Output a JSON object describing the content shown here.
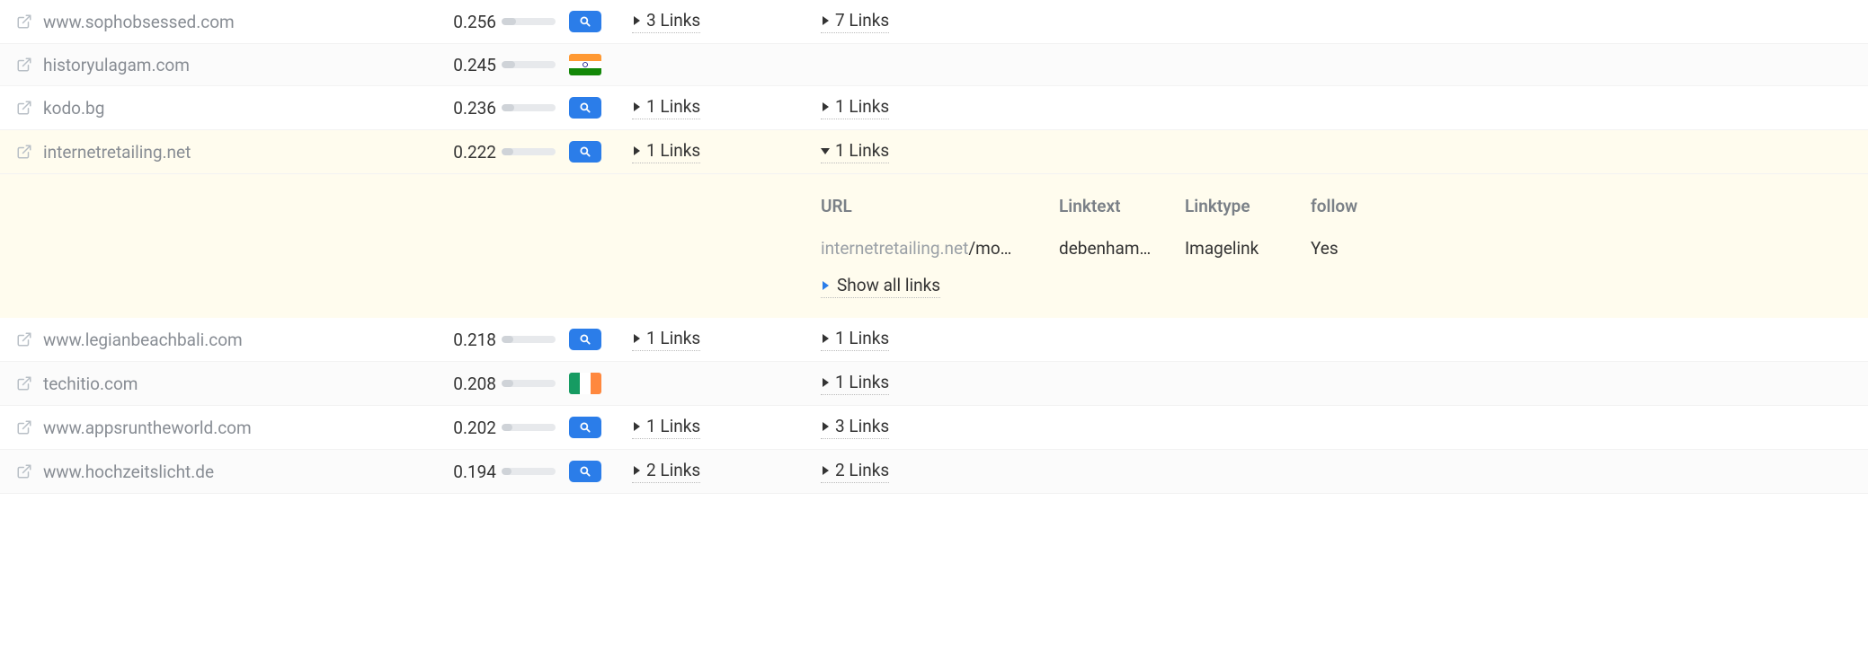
{
  "rows": [
    {
      "domain": "www.sophobsessed.com",
      "score": "0.256",
      "bar_pct": 26,
      "badge": "search",
      "links1": "3 Links",
      "links2": "7 Links",
      "alt": false,
      "expanded": false
    },
    {
      "domain": "historyulagam.com",
      "score": "0.245",
      "bar_pct": 25,
      "badge": "flag-in",
      "links1": "",
      "links2": "",
      "alt": true,
      "expanded": false
    },
    {
      "domain": "kodo.bg",
      "score": "0.236",
      "bar_pct": 24,
      "badge": "search",
      "links1": "1 Links",
      "links2": "1 Links",
      "alt": false,
      "expanded": false
    },
    {
      "domain": "internetretailing.net",
      "score": "0.222",
      "bar_pct": 22,
      "badge": "search",
      "links1": "1 Links",
      "links2": "1 Links",
      "alt": false,
      "expanded": true
    },
    {
      "domain": "www.legianbeachbali.com",
      "score": "0.218",
      "bar_pct": 22,
      "badge": "search",
      "links1": "1 Links",
      "links2": "1 Links",
      "alt": false,
      "expanded": false
    },
    {
      "domain": "techitio.com",
      "score": "0.208",
      "bar_pct": 21,
      "badge": "flag-ie",
      "links1": "",
      "links2": "1 Links",
      "alt": true,
      "expanded": false
    },
    {
      "domain": "www.appsruntheworld.com",
      "score": "0.202",
      "bar_pct": 20,
      "badge": "search",
      "links1": "1 Links",
      "links2": "3 Links",
      "alt": false,
      "expanded": false
    },
    {
      "domain": "www.hochzeitslicht.de",
      "score": "0.194",
      "bar_pct": 19,
      "badge": "search",
      "links1": "2 Links",
      "links2": "2 Links",
      "alt": true,
      "expanded": false
    }
  ],
  "details": {
    "headers": {
      "url": "URL",
      "linktext": "Linktext",
      "linktype": "Linktype",
      "follow": "follow"
    },
    "item": {
      "url_host": "internetretailing.net",
      "url_path": "/mo…",
      "linktext": "debenham…",
      "linktype": "Imagelink",
      "follow": "Yes"
    },
    "show_all": "Show all links"
  }
}
